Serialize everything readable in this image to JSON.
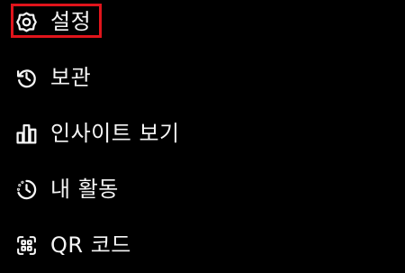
{
  "menu": {
    "items": [
      {
        "label": "설정",
        "icon": "settings-gear-icon"
      },
      {
        "label": "보관",
        "icon": "archive-history-icon"
      },
      {
        "label": "인사이트 보기",
        "icon": "insights-bar-chart-icon"
      },
      {
        "label": "내 활동",
        "icon": "activity-clock-icon"
      },
      {
        "label": "QR 코드",
        "icon": "qr-code-icon"
      }
    ],
    "highlighted_item": "설정"
  },
  "colors": {
    "background": "#000000",
    "text": "#f5f5f5",
    "highlight_border": "#e0141b"
  }
}
